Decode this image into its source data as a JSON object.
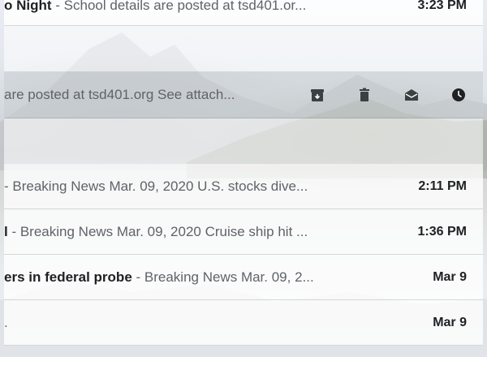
{
  "inbox": {
    "rows": [
      {
        "subject": "o Night",
        "separator": " - ",
        "snippet": "School details are posted at tsd401.or...",
        "time": "3:23 PM"
      },
      {
        "snippet": "are posted at tsd401.org See attach...",
        "actions": [
          {
            "icon": "archive-icon"
          },
          {
            "icon": "delete-icon"
          },
          {
            "icon": "mark-as-read-icon"
          },
          {
            "icon": "snooze-icon"
          }
        ]
      },
      {
        "subject": "",
        "separator": "- ",
        "snippet": "Breaking News Mar. 09, 2020 U.S. stocks dive...",
        "time": "2:11 PM"
      },
      {
        "subject": "l",
        "separator": " - ",
        "snippet": "Breaking News Mar. 09, 2020 Cruise ship hit ...",
        "time": "1:36 PM"
      },
      {
        "subject": "ers in federal probe",
        "separator": " - ",
        "snippet": "Breaking News Mar. 09, 2...",
        "time": "Mar 9"
      },
      {
        "subject": "",
        "separator": "",
        "snippet": ".",
        "time": "Mar 9"
      }
    ]
  },
  "colors": {
    "text_primary": "#202124",
    "text_secondary": "#5f6368",
    "icon": "#3c4043"
  }
}
